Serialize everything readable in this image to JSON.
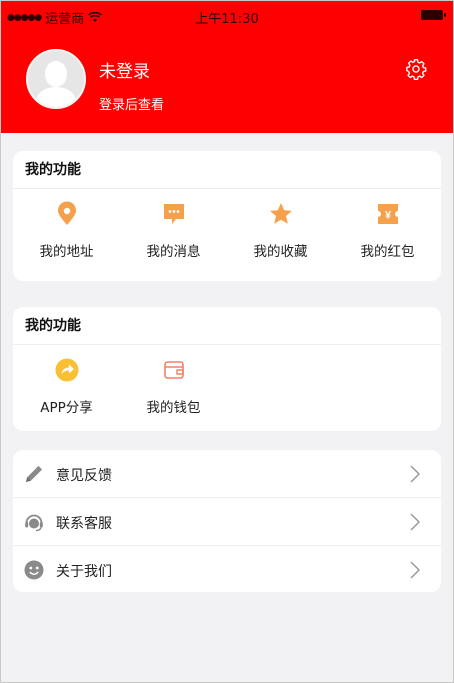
{
  "status_bar": {
    "carrier": "运营商",
    "time": "上午11:30"
  },
  "profile": {
    "username": "未登录",
    "login_hint": "登录后查看"
  },
  "functions_card_1": {
    "title": "我的功能",
    "items": [
      {
        "label": "我的地址",
        "icon": "location-icon"
      },
      {
        "label": "我的消息",
        "icon": "message-icon"
      },
      {
        "label": "我的收藏",
        "icon": "star-icon"
      },
      {
        "label": "我的红包",
        "icon": "red-packet-icon"
      }
    ]
  },
  "functions_card_2": {
    "title": "我的功能",
    "items": [
      {
        "label": "APP分享",
        "icon": "share-icon"
      },
      {
        "label": "我的钱包",
        "icon": "wallet-icon"
      }
    ]
  },
  "menu_list": [
    {
      "label": "意见反馈",
      "icon": "pencil-icon"
    },
    {
      "label": "联系客服",
      "icon": "headset-icon"
    },
    {
      "label": "关于我们",
      "icon": "smiley-icon"
    }
  ],
  "colors": {
    "header": "#ff0000",
    "accent_orange": "#f5a04a",
    "background": "#f2f2f4"
  }
}
